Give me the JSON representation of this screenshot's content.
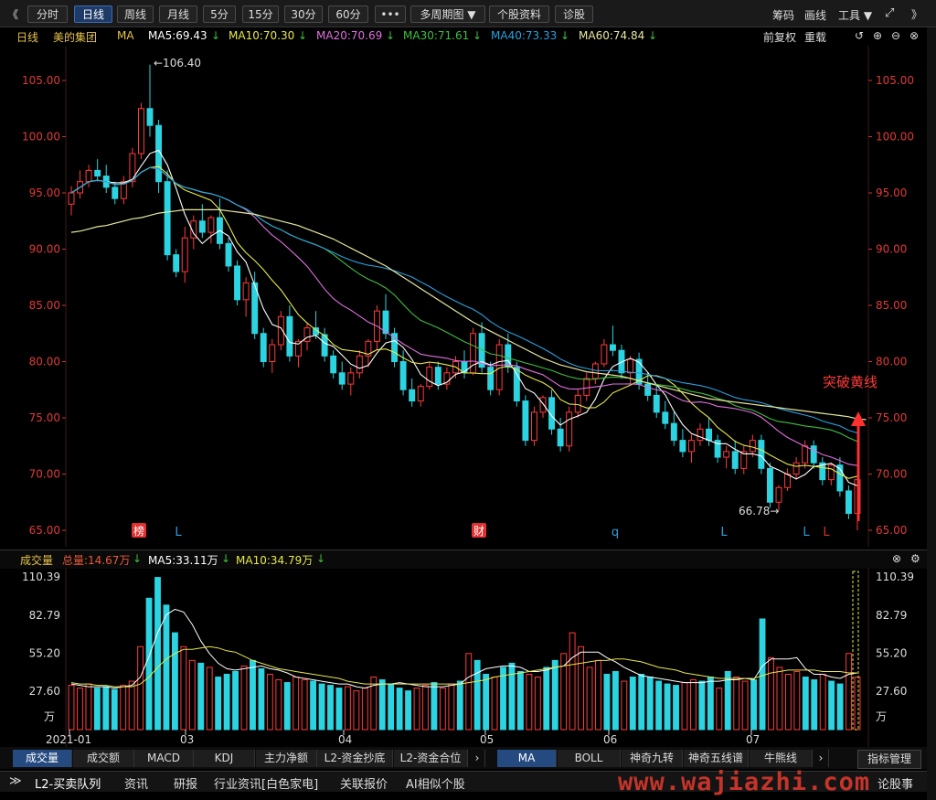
{
  "toolbar": {
    "back": "《",
    "tabs": [
      "分时",
      "日线",
      "周线",
      "月线",
      "5分",
      "15分",
      "30分",
      "60分",
      "•••",
      "多周期图 ▼",
      "个股资料",
      "诊股"
    ],
    "active_tab": "日线",
    "right": {
      "chips": "筹码",
      "draw": "画线",
      "tools": "工具 ▼",
      "forward": "》"
    }
  },
  "info": {
    "period": "日线",
    "stock": "美的集团",
    "ma_label": "MA",
    "ma5": "MA5:69.43",
    "ma10": "MA10:70.30",
    "ma20": "MA20:70.69",
    "ma30": "MA30:71.61",
    "ma40": "MA40:73.33",
    "ma60": "MA60:74.84",
    "adjust": "前复权",
    "reload": "重载",
    "colors": {
      "ma5": "#ffffff",
      "ma10": "#e8e84a",
      "ma20": "#e070e0",
      "ma30": "#3fbf3f",
      "ma40": "#2aa0e0",
      "ma60": "#e8e8a0"
    }
  },
  "price_axis": {
    "labels": [
      "105.00",
      "100.00",
      "95.00",
      "90.00",
      "85.00",
      "80.00",
      "75.00",
      "70.00",
      "65.00"
    ],
    "values": [
      105,
      100,
      95,
      90,
      85,
      80,
      75,
      70,
      65
    ]
  },
  "annotations": {
    "high": "←106.40",
    "low": "66.78→",
    "breakout": "突破黄线"
  },
  "markers": [
    {
      "label": "榜",
      "type": "box"
    },
    {
      "label": "L",
      "type": "text"
    },
    {
      "label": "财",
      "type": "box"
    },
    {
      "label": "q",
      "type": "text"
    },
    {
      "label": "L",
      "type": "text"
    },
    {
      "label": "L",
      "type": "text"
    },
    {
      "label": "L",
      "type": "text"
    }
  ],
  "volume_header": {
    "title": "成交量",
    "total": "总量:14.67万",
    "ma5": "MA5:33.11万",
    "ma10": "MA10:34.79万"
  },
  "volume_axis": {
    "labels": [
      "110.39",
      "82.79",
      "55.20",
      "27.60"
    ],
    "unit": "万"
  },
  "date_axis": [
    "2021-01",
    "03",
    "04",
    "05",
    "06",
    "07"
  ],
  "indicator_tabs": [
    "成交量",
    "成交额",
    "MACD",
    "KDJ",
    "主力净额",
    "L2-资金抄底",
    "L2-资金合位"
  ],
  "indicator_tabs2": [
    "MA",
    "BOLL",
    "神奇九转",
    "神奇五线谱",
    "牛熊线"
  ],
  "indicator_manage": "指标管理",
  "bottom_tabs": [
    "L2-买卖队列",
    "资讯",
    "研报",
    "行业资讯[白色家电]",
    "关联报价",
    "AI相似个股"
  ],
  "bottom_right": "论股事",
  "watermark": "www.wajiazhi.com",
  "chart_data": {
    "type": "candlestick",
    "ohlc": [
      [
        94,
        95.6,
        93,
        95
      ],
      [
        95,
        97,
        94.5,
        96
      ],
      [
        96,
        97.5,
        95.5,
        97
      ],
      [
        97,
        98,
        96,
        96.5
      ],
      [
        96.5,
        97.5,
        95,
        95.5
      ],
      [
        95.5,
        96,
        94,
        94.5
      ],
      [
        94.5,
        96.5,
        94,
        96
      ],
      [
        96,
        99,
        95.5,
        98.5
      ],
      [
        98.5,
        103,
        98,
        102.5
      ],
      [
        102.5,
        106.4,
        100,
        101
      ],
      [
        101,
        101.5,
        95,
        96
      ],
      [
        96,
        97,
        89,
        89.5
      ],
      [
        89.5,
        90,
        87.5,
        88
      ],
      [
        88,
        92,
        87,
        91
      ],
      [
        91,
        93,
        90,
        92.5
      ],
      [
        92.5,
        94,
        91,
        91.5
      ],
      [
        91.5,
        93,
        90.5,
        92.8
      ],
      [
        92.8,
        94.5,
        90,
        90.5
      ],
      [
        90.5,
        91,
        88,
        88.5
      ],
      [
        88.5,
        89,
        85,
        85.5
      ],
      [
        85.5,
        87.5,
        84,
        87
      ],
      [
        87,
        88,
        82,
        82.5
      ],
      [
        82.5,
        83,
        79.5,
        80
      ],
      [
        80,
        82,
        79,
        81.5
      ],
      [
        81.5,
        84.5,
        81,
        84
      ],
      [
        84,
        85,
        80,
        80.5
      ],
      [
        80.5,
        82,
        79.5,
        81.8
      ],
      [
        81.8,
        83.5,
        81,
        83
      ],
      [
        83,
        84.5,
        82,
        82.4
      ],
      [
        82.4,
        83,
        80,
        80.5
      ],
      [
        80.5,
        81,
        78.5,
        79
      ],
      [
        79,
        80,
        77.5,
        78
      ],
      [
        78,
        79.5,
        77,
        79
      ],
      [
        79,
        81,
        78.5,
        80.5
      ],
      [
        80.5,
        82,
        79.5,
        81.8
      ],
      [
        81.8,
        85,
        81,
        84.5
      ],
      [
        84.5,
        86,
        82,
        82.5
      ],
      [
        82.5,
        83,
        79.5,
        80
      ],
      [
        80,
        81,
        77,
        77.5
      ],
      [
        77.5,
        78.5,
        76,
        76.5
      ],
      [
        76.5,
        78,
        76,
        77.8
      ],
      [
        77.8,
        80,
        77.5,
        79.5
      ],
      [
        79.5,
        80,
        77.5,
        78
      ],
      [
        78,
        79.5,
        77.5,
        79
      ],
      [
        79,
        80.5,
        78.5,
        80
      ],
      [
        80,
        81,
        78.5,
        79
      ],
      [
        79,
        83,
        78.8,
        82.5
      ],
      [
        82.5,
        83.5,
        79,
        79.5
      ],
      [
        79.5,
        80,
        77,
        77.5
      ],
      [
        77.5,
        82,
        77,
        81.5
      ],
      [
        81.5,
        82.5,
        79,
        79.5
      ],
      [
        79.5,
        80,
        76,
        76.5
      ],
      [
        76.5,
        77,
        72.5,
        73
      ],
      [
        73,
        76,
        72.5,
        75.5
      ],
      [
        75.5,
        77,
        75,
        76.8
      ],
      [
        76.8,
        77.5,
        73.5,
        74
      ],
      [
        74,
        75,
        72,
        72.5
      ],
      [
        72.5,
        76,
        72,
        75.5
      ],
      [
        75.5,
        77.5,
        75,
        77
      ],
      [
        77,
        79,
        76.5,
        78.5
      ],
      [
        78.5,
        80,
        78,
        79.8
      ],
      [
        79.8,
        82,
        79.5,
        81.5
      ],
      [
        81.5,
        83.2,
        80.5,
        81
      ],
      [
        81,
        81.5,
        78.5,
        79
      ],
      [
        79,
        80.5,
        78,
        80.2
      ],
      [
        80.2,
        80.8,
        77.5,
        78
      ],
      [
        78,
        79,
        76.5,
        77
      ],
      [
        77,
        78,
        75,
        75.5
      ],
      [
        75.5,
        76.5,
        74,
        74.5
      ],
      [
        74.5,
        75.5,
        72.5,
        73
      ],
      [
        73,
        74,
        71.5,
        72
      ],
      [
        72,
        73.5,
        71,
        73
      ],
      [
        73,
        74.5,
        72.5,
        74
      ],
      [
        74,
        75,
        72.5,
        73
      ],
      [
        73,
        73.5,
        71,
        71.5
      ],
      [
        71.5,
        72.5,
        70.5,
        72
      ],
      [
        72,
        73,
        70,
        70.5
      ],
      [
        70.5,
        72.5,
        70,
        72
      ],
      [
        72,
        73.5,
        71.5,
        73
      ],
      [
        73,
        73.5,
        70,
        70.5
      ],
      [
        70.5,
        71,
        67,
        67.5
      ],
      [
        67.5,
        69,
        66.78,
        68.8
      ],
      [
        68.8,
        70.5,
        68.5,
        70
      ],
      [
        70,
        71.5,
        69.5,
        71
      ],
      [
        71,
        73,
        70.5,
        72.5
      ],
      [
        72.5,
        73,
        70.5,
        71
      ],
      [
        71,
        71.5,
        69,
        69.5
      ],
      [
        69.5,
        71,
        69,
        70.8
      ],
      [
        70.8,
        71.5,
        68,
        68.5
      ],
      [
        68.5,
        69,
        66,
        66.5
      ],
      [
        66.5,
        70,
        65,
        69.5
      ]
    ],
    "volume": [
      32,
      30,
      33,
      30,
      31,
      29,
      32,
      35,
      60,
      95,
      110,
      90,
      70,
      60,
      50,
      48,
      45,
      38,
      40,
      42,
      46,
      50,
      44,
      40,
      36,
      34,
      38,
      36,
      35,
      33,
      32,
      30,
      31,
      28,
      30,
      38,
      36,
      33,
      30,
      28,
      30,
      32,
      34,
      30,
      33,
      35,
      55,
      50,
      40,
      38,
      45,
      48,
      42,
      40,
      38,
      45,
      50,
      55,
      70,
      60,
      45,
      50,
      40,
      42,
      35,
      38,
      40,
      38,
      35,
      33,
      32,
      34,
      36,
      35,
      38,
      30,
      42,
      38,
      35,
      36,
      80,
      52,
      45,
      40,
      42,
      38,
      36,
      40,
      35,
      33,
      55,
      38
    ],
    "ma5_vol": [
      33,
      32,
      31,
      31,
      31,
      30,
      31,
      32,
      38,
      53,
      70,
      83,
      87,
      85,
      76,
      64,
      55,
      48,
      44,
      43,
      44,
      45,
      46,
      44,
      43,
      41,
      38,
      37,
      36,
      35,
      34,
      33,
      33,
      31,
      30,
      32,
      33,
      33,
      34,
      33,
      32,
      31,
      31,
      31,
      32,
      33,
      38,
      41,
      44,
      45,
      46,
      46,
      45,
      42,
      42,
      43,
      45,
      46,
      52,
      56,
      56,
      56,
      52,
      49,
      45,
      42,
      39,
      38,
      37,
      36,
      35,
      34,
      34,
      34,
      35,
      35,
      36,
      36,
      37,
      36,
      46,
      51,
      51,
      51,
      52,
      44,
      40,
      40,
      38,
      37,
      40,
      41
    ],
    "ma10_vol": [
      34,
      33,
      33,
      32,
      32,
      31,
      31,
      31,
      33,
      38,
      45,
      51,
      55,
      58,
      58,
      59,
      60,
      59,
      57,
      56,
      53,
      50,
      48,
      46,
      44,
      43,
      42,
      41,
      40,
      39,
      38,
      37,
      35,
      34,
      33,
      33,
      33,
      33,
      33,
      33,
      33,
      33,
      33,
      33,
      33,
      33,
      34,
      35,
      36,
      38,
      39,
      40,
      41,
      42,
      43,
      44,
      45,
      46,
      47,
      48,
      49,
      50,
      50,
      51,
      51,
      50,
      49,
      47,
      45,
      44,
      43,
      41,
      40,
      39,
      38,
      37,
      37,
      37,
      37,
      37,
      39,
      41,
      42,
      43,
      43,
      43,
      43,
      42,
      42,
      42,
      41,
      41
    ],
    "ma60": [
      91.5,
      91.6,
      91.8,
      92,
      92.1,
      92.3,
      92.5,
      92.7,
      92.8,
      93,
      93.2,
      93.3,
      93.4,
      93.5,
      93.5,
      93.5,
      93.5,
      93.5,
      93.4,
      93.3,
      93.2,
      93.1,
      92.9,
      92.7,
      92.5,
      92.3,
      92.1,
      91.8,
      91.5,
      91.2,
      90.9,
      90.5,
      90.1,
      89.7,
      89.3,
      88.9,
      88.5,
      88,
      87.5,
      87,
      86.5,
      86,
      85.5,
      85,
      84.5,
      84,
      83.5,
      83.1,
      82.7,
      82.3,
      81.9,
      81.5,
      81.1,
      80.7,
      80.3,
      80,
      79.7,
      79.5,
      79.3,
      79.1,
      79,
      78.9,
      78.8,
      78.7,
      78.5,
      78.3,
      78.1,
      77.9,
      77.7,
      77.5,
      77.3,
      77.1,
      76.9,
      76.7,
      76.6,
      76.5,
      76.4,
      76.3,
      76.2,
      76.1,
      76,
      75.9,
      75.8,
      75.7,
      75.6,
      75.5,
      75.4,
      75.3,
      75.2,
      75.1,
      74.9,
      74.84
    ],
    "ylim": [
      65,
      106.4
    ],
    "vol_ylim": [
      0,
      110.39
    ],
    "x_ticks": [
      "2021-01",
      "03",
      "04",
      "05",
      "06",
      "07"
    ]
  }
}
